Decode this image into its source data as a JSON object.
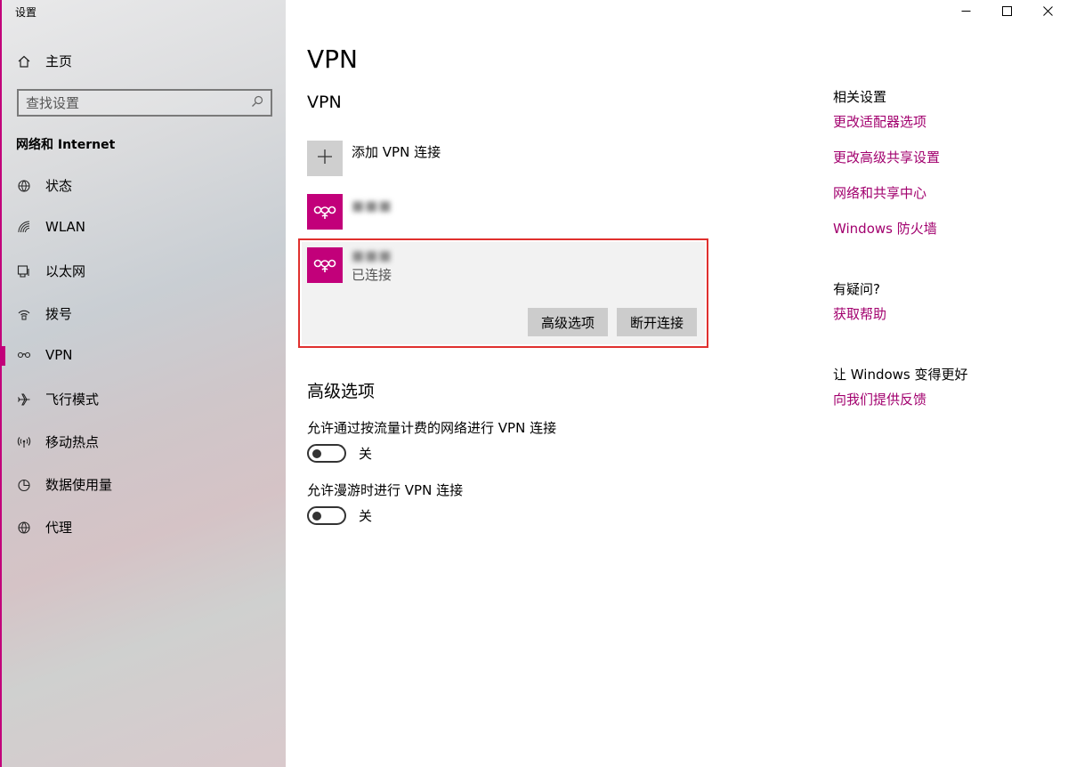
{
  "window": {
    "app_title": "设置",
    "minimize_icon": "minimize-icon",
    "maximize_icon": "maximize-icon",
    "close_icon": "close-icon"
  },
  "sidebar": {
    "home_label": "主页",
    "search_placeholder": "查找设置",
    "section_title": "网络和 Internet",
    "items": [
      {
        "label": "状态",
        "icon": "globe-status-icon"
      },
      {
        "label": "WLAN",
        "icon": "wifi-icon"
      },
      {
        "label": "以太网",
        "icon": "ethernet-icon"
      },
      {
        "label": "拨号",
        "icon": "dialup-icon"
      },
      {
        "label": "VPN",
        "icon": "vpn-icon",
        "active": true
      },
      {
        "label": "飞行模式",
        "icon": "airplane-icon"
      },
      {
        "label": "移动热点",
        "icon": "hotspot-icon"
      },
      {
        "label": "数据使用量",
        "icon": "data-usage-icon"
      },
      {
        "label": "代理",
        "icon": "globe-icon"
      }
    ],
    "accent_color": "#c2007a"
  },
  "main": {
    "page_title": "VPN",
    "vpn_section_title": "VPN",
    "add_vpn_label": "添加 VPN 连接",
    "connections": [
      {
        "name": "■■■",
        "status": ""
      },
      {
        "name": "■■■",
        "status": "已连接"
      }
    ],
    "buttons": {
      "advanced": "高级选项",
      "disconnect": "断开连接"
    },
    "advanced_title": "高级选项",
    "options": [
      {
        "label": "允许通过按流量计费的网络进行 VPN 连接",
        "state": "关",
        "on": false
      },
      {
        "label": "允许漫游时进行 VPN 连接",
        "state": "关",
        "on": false
      }
    ]
  },
  "related": {
    "title": "相关设置",
    "links": [
      "更改适配器选项",
      "更改高级共享设置",
      "网络和共享中心",
      "Windows 防火墙"
    ],
    "question_title": "有疑问?",
    "help_link": "获取帮助",
    "improve_title": "让 Windows 变得更好",
    "feedback_link": "向我们提供反馈",
    "link_color": "#a2006e"
  }
}
